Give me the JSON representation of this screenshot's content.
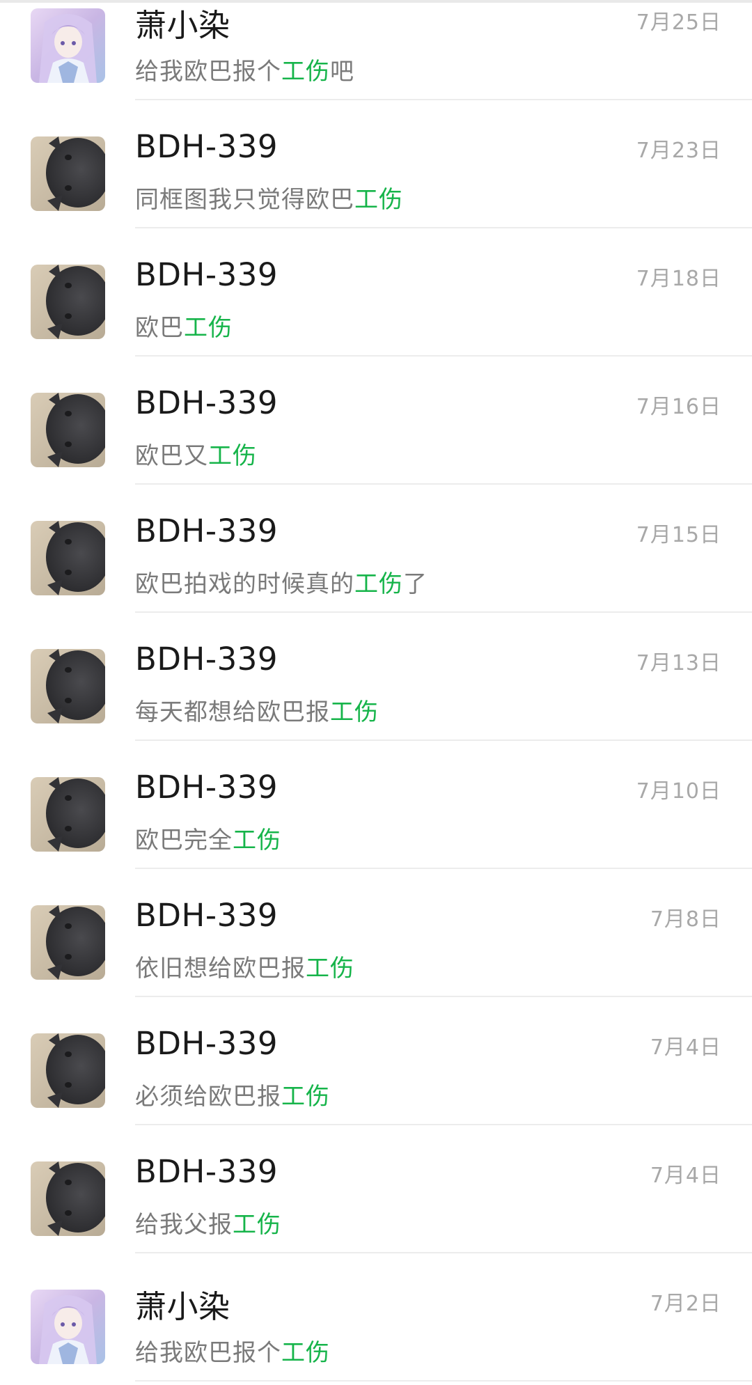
{
  "conversations": [
    {
      "name": "萧小染",
      "avatar": "anime-girl-avatar",
      "date": "7月25日",
      "msg_pre": "给我欧巴报个",
      "msg_hl": "工伤",
      "msg_post": "吧"
    },
    {
      "name": "BDH-339",
      "avatar": "gray-cat-avatar",
      "date": "7月23日",
      "msg_pre": "同框图我只觉得欧巴",
      "msg_hl": "工伤",
      "msg_post": ""
    },
    {
      "name": "BDH-339",
      "avatar": "gray-cat-avatar",
      "date": "7月18日",
      "msg_pre": "欧巴",
      "msg_hl": "工伤",
      "msg_post": ""
    },
    {
      "name": "BDH-339",
      "avatar": "gray-cat-avatar",
      "date": "7月16日",
      "msg_pre": "欧巴又",
      "msg_hl": "工伤",
      "msg_post": ""
    },
    {
      "name": "BDH-339",
      "avatar": "gray-cat-avatar",
      "date": "7月15日",
      "msg_pre": "欧巴拍戏的时候真的",
      "msg_hl": "工伤",
      "msg_post": "了"
    },
    {
      "name": "BDH-339",
      "avatar": "gray-cat-avatar",
      "date": "7月13日",
      "msg_pre": "每天都想给欧巴报",
      "msg_hl": "工伤",
      "msg_post": ""
    },
    {
      "name": "BDH-339",
      "avatar": "gray-cat-avatar",
      "date": "7月10日",
      "msg_pre": "欧巴完全",
      "msg_hl": "工伤",
      "msg_post": ""
    },
    {
      "name": "BDH-339",
      "avatar": "gray-cat-avatar",
      "date": "7月8日",
      "msg_pre": "依旧想给欧巴报",
      "msg_hl": "工伤",
      "msg_post": ""
    },
    {
      "name": "BDH-339",
      "avatar": "gray-cat-avatar",
      "date": "7月4日",
      "msg_pre": "必须给欧巴报",
      "msg_hl": "工伤",
      "msg_post": ""
    },
    {
      "name": "BDH-339",
      "avatar": "gray-cat-avatar",
      "date": "7月4日",
      "msg_pre": "给我父报",
      "msg_hl": "工伤",
      "msg_post": ""
    },
    {
      "name": "萧小染",
      "avatar": "anime-girl-avatar",
      "date": "7月2日",
      "msg_pre": "给我欧巴报个",
      "msg_hl": "工伤",
      "msg_post": ""
    }
  ],
  "colors": {
    "highlight": "#16b44a",
    "name_text": "#1a1a1a",
    "message_text": "#7a7a7a",
    "date_text": "#a8a8a8",
    "divider": "#ececec"
  }
}
